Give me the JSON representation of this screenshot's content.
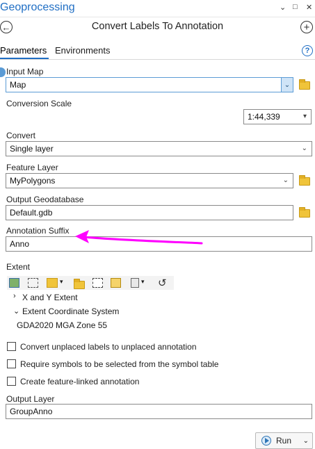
{
  "pane": {
    "title": "Geoprocessing",
    "controls": {
      "menu": "⌄",
      "maximize": "□",
      "close": "✕"
    }
  },
  "header": {
    "back_icon": "←",
    "tool_title": "Convert Labels To Annotation",
    "add_icon": "+"
  },
  "tabs": [
    {
      "label": "Parameters",
      "active": true
    },
    {
      "label": "Environments",
      "active": false
    }
  ],
  "help_icon": "?",
  "params": {
    "input_map": {
      "label": "Input Map",
      "value": "Map"
    },
    "conversion_scale": {
      "label": "Conversion Scale",
      "value": "1:44,339"
    },
    "convert": {
      "label": "Convert",
      "value": "Single layer"
    },
    "feature_layer": {
      "label": "Feature Layer",
      "value": "MyPolygons"
    },
    "output_geodatabase": {
      "label": "Output Geodatabase",
      "value": "Default.gdb"
    },
    "annotation_suffix": {
      "label": "Annotation Suffix",
      "value": "Anno"
    },
    "extent": {
      "label": "Extent",
      "xy_label": "X and Y Extent",
      "coord_label": "Extent Coordinate System",
      "coord_value": "GDA2020 MGA Zone 55"
    },
    "checkboxes": [
      {
        "label": "Convert unplaced labels to unplaced annotation",
        "checked": false
      },
      {
        "label": "Require symbols to be selected from the symbol table",
        "checked": false
      },
      {
        "label": "Create feature-linked annotation",
        "checked": false
      }
    ],
    "output_layer": {
      "label": "Output Layer",
      "value": "GroupAnno"
    }
  },
  "run_button": {
    "label": "Run",
    "dropdown": "⌄"
  },
  "annotation_arrow_color": "#ff00ff",
  "accent_color": "#1f6ec4"
}
